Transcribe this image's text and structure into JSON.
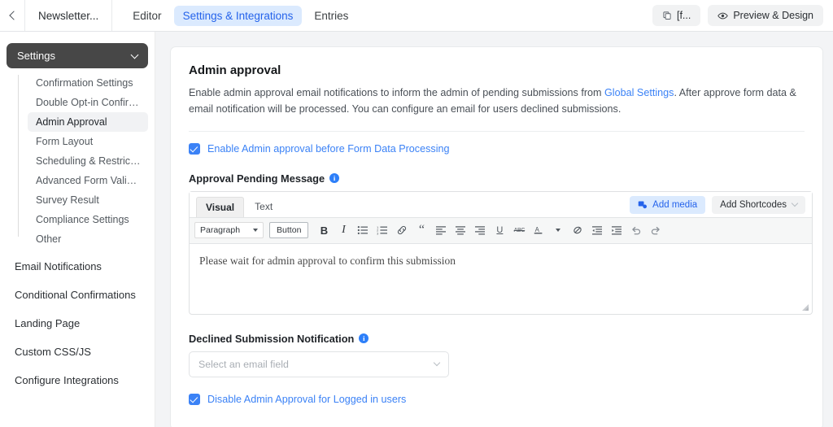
{
  "topbar": {
    "back_icon": "chevron-left-icon",
    "form_name": "Newsletter...",
    "tabs": [
      {
        "label": "Editor",
        "active": false
      },
      {
        "label": "Settings & Integrations",
        "active": true
      },
      {
        "label": "Entries",
        "active": false
      }
    ],
    "buttons": [
      {
        "label": "[f...",
        "icon": "copy-icon"
      },
      {
        "label": "Preview & Design",
        "icon": "eye-icon"
      }
    ]
  },
  "sidebar": {
    "header": {
      "label": "Settings",
      "icon": "chevron-down-icon"
    },
    "sub_items": [
      {
        "label": "Confirmation Settings",
        "active": false
      },
      {
        "label": "Double Opt-in Confirma...",
        "active": false
      },
      {
        "label": "Admin Approval",
        "active": true
      },
      {
        "label": "Form Layout",
        "active": false
      },
      {
        "label": "Scheduling & Restrictions",
        "active": false
      },
      {
        "label": "Advanced Form Validati...",
        "active": false
      },
      {
        "label": "Survey Result",
        "active": false
      },
      {
        "label": "Compliance Settings",
        "active": false
      },
      {
        "label": "Other",
        "active": false
      }
    ],
    "root_items": [
      {
        "label": "Email Notifications"
      },
      {
        "label": "Conditional Confirmations"
      },
      {
        "label": "Landing Page"
      },
      {
        "label": "Custom CSS/JS"
      },
      {
        "label": "Configure Integrations"
      }
    ]
  },
  "main": {
    "title": "Admin approval",
    "desc_part1": "Enable admin approval email notifications to inform the admin of pending submissions from ",
    "desc_link": "Global Settings",
    "desc_part2": ". After approve form data & email notification will be processed. You can configure an email for users declined submissions.",
    "enable_checkbox": {
      "label": "Enable Admin approval before Form Data Processing",
      "checked": true
    },
    "pending_message": {
      "label": "Approval Pending Message",
      "info_icon": "info-icon",
      "editor": {
        "tabs": [
          {
            "label": "Visual",
            "active": true
          },
          {
            "label": "Text",
            "active": false
          }
        ],
        "add_media": {
          "label": "Add media",
          "icon": "media-icon"
        },
        "shortcodes": {
          "label": "Add Shortcodes",
          "icon": "chevron-down-icon"
        },
        "format_select": "Paragraph",
        "button_tool": "Button",
        "tools": [
          {
            "name": "bold-icon",
            "glyph": "B"
          },
          {
            "name": "italic-icon",
            "glyph": "I"
          },
          {
            "name": "bulleted-list-icon",
            "glyph": "☰"
          },
          {
            "name": "numbered-list-icon",
            "glyph": "≡"
          },
          {
            "name": "link-icon",
            "glyph": "ὑ7"
          },
          {
            "name": "blockquote-icon",
            "glyph": "“"
          },
          {
            "name": "align-left-icon",
            "glyph": "≡"
          },
          {
            "name": "align-center-icon",
            "glyph": "≡"
          },
          {
            "name": "align-right-icon",
            "glyph": "≡"
          },
          {
            "name": "underline-icon",
            "glyph": "U"
          },
          {
            "name": "strikethrough-icon",
            "glyph": "ABC"
          },
          {
            "name": "text-color-icon",
            "glyph": "A"
          },
          {
            "name": "clear-formatting-icon",
            "glyph": "○"
          },
          {
            "name": "decrease-indent-icon",
            "glyph": "≡"
          },
          {
            "name": "increase-indent-icon",
            "glyph": "≡"
          },
          {
            "name": "undo-icon",
            "glyph": "↶"
          },
          {
            "name": "redo-icon",
            "glyph": "↷"
          }
        ],
        "content": "Please wait for admin approval to confirm this submission"
      }
    },
    "declined_notification": {
      "label": "Declined Submission Notification",
      "info_icon": "info-icon",
      "select_placeholder": "Select an email field",
      "select_value": ""
    },
    "disable_checkbox": {
      "label": "Disable Admin Approval for Logged in users",
      "checked": true
    }
  },
  "colors": {
    "accent_blue": "#3b82f6",
    "tab_active_bg": "#dbeafe",
    "sidebar_header_bg": "#474747"
  }
}
